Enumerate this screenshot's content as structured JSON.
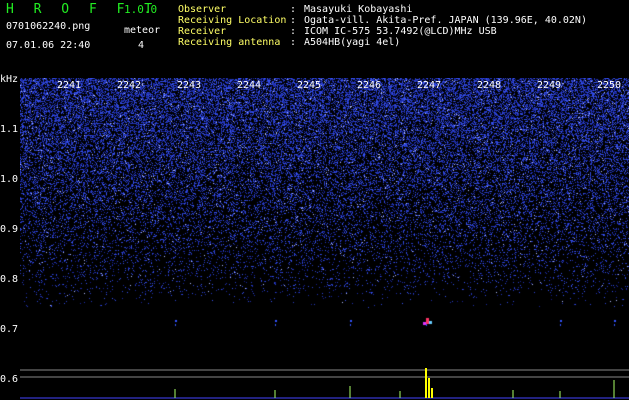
{
  "header": {
    "app_name": "H R O F F T",
    "version": "1.0.0",
    "filename": "0701062240.png",
    "datetime": "07.01.06 22:40",
    "event_label": "meteor",
    "event_count": "4"
  },
  "metadata": [
    {
      "key": "Observer",
      "value": "Masayuki Kobayashi"
    },
    {
      "key": "Receiving Location",
      "value": "Ogata-vill. Akita-Pref. JAPAN (139.96E, 40.02N)"
    },
    {
      "key": "Receiver",
      "value": "ICOM IC-575 53.7492(@LCD)MHz USB"
    },
    {
      "key": "Receiving antenna",
      "value": "A504HB(yagi 4el)"
    }
  ],
  "y_unit": "kHz",
  "y_ticks": [
    "1.1",
    "1.0",
    "0.9",
    "0.8",
    "0.7",
    "0.6"
  ],
  "x_ticks": [
    "2241",
    "2242",
    "2243",
    "2244",
    "2245",
    "2246",
    "2247",
    "2248",
    "2249",
    "2250"
  ],
  "colors": {
    "background": "#000000",
    "noise": "#2233ff",
    "echo": "#ff3366",
    "spectrum": "#ffff00",
    "app_green": "#22ee22"
  }
}
